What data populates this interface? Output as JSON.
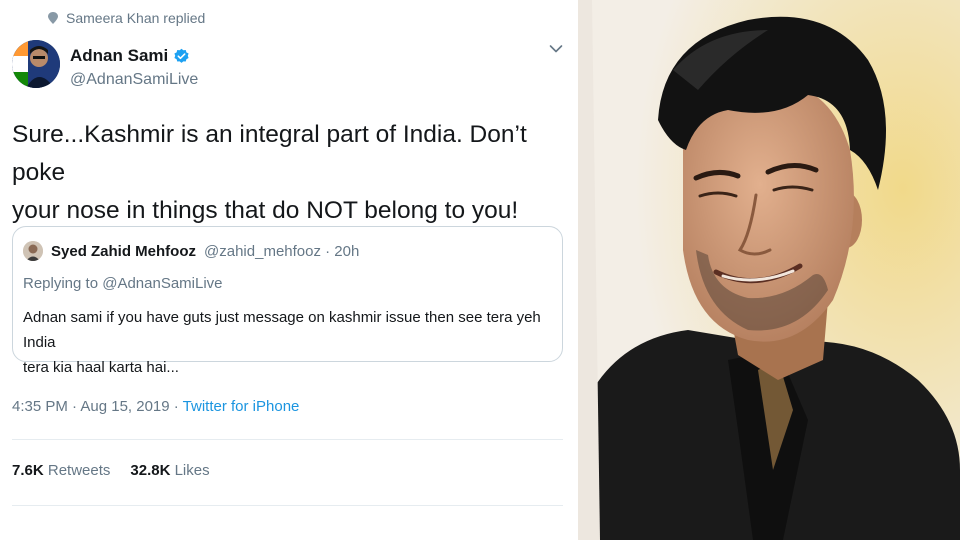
{
  "context": {
    "text": "Sameera Khan replied"
  },
  "tweet": {
    "author_name": "Adnan Sami",
    "author_handle": "@AdnanSamiLive",
    "text_line1": "Sure...Kashmir is an integral part of India. Don’t poke",
    "text_line2": "your nose in things that do NOT belong to you!",
    "timestamp": "4:35 PM · Aug 15, 2019 · ",
    "source": "Twitter for iPhone",
    "retweets_count": "7.6K",
    "retweets_label": "Retweets",
    "likes_count": "32.8K",
    "likes_label": "Likes"
  },
  "quote": {
    "author_name": "Syed Zahid Mehfooz",
    "author_handle": "@zahid_mehfooz · 20h",
    "replying_prefix": "Replying to ",
    "replying_to": "@AdnanSamiLive",
    "text_line1": "Adnan sami if you have guts just message on kashmir issue then see tera yeh India",
    "text_line2": "tera kia haal karta hai..."
  },
  "colors": {
    "text": "#14171a",
    "secondary": "#657786",
    "link": "#1b95e0",
    "verified": "#1da1f2",
    "border": "#ccd6dd"
  },
  "icons": [
    "pin-icon",
    "verified-badge-icon",
    "chevron-down-icon"
  ]
}
